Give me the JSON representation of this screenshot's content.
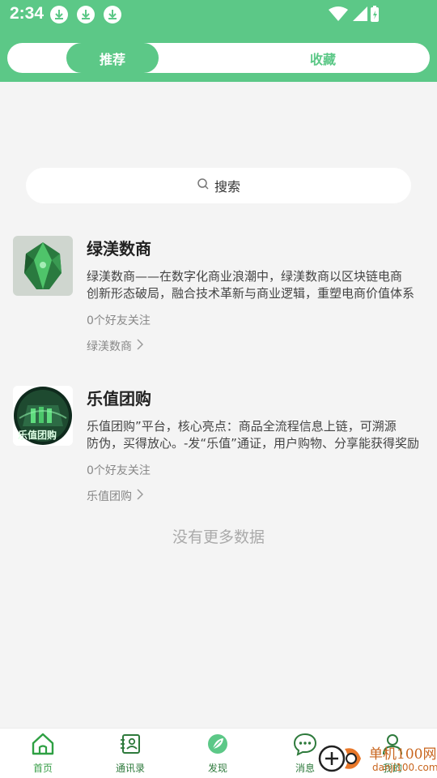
{
  "status_bar": {
    "time": "2:34"
  },
  "tabs": [
    {
      "label": "推荐",
      "active": true
    },
    {
      "label": "收藏",
      "active": false
    }
  ],
  "search": {
    "label": "搜索"
  },
  "items": [
    {
      "title": "绿渼数商",
      "desc_line1": "绿渼数商——在数字化商业浪潮中，绿渼数商以区块链电商",
      "desc_line2": "创新形态破局，融合技术革新与商业逻辑，重塑电商价值体系",
      "followers": "0个好友关注",
      "link": "绿渼数商"
    },
    {
      "title": "乐值团购",
      "desc_line1": "乐值团购”平台，核心亮点：商品全流程信息上链，可溯源",
      "desc_line2": "防伪，买得放心。-发“乐值”通证，用户购物、分享能获得奖励",
      "followers": "0个好友关注",
      "link": "乐值团购",
      "thumb_text": "乐值团购"
    }
  ],
  "no_more": "没有更多数据",
  "bottom_nav": [
    {
      "label": "首页",
      "icon": "home-icon"
    },
    {
      "label": "通讯录",
      "icon": "contacts-icon"
    },
    {
      "label": "发现",
      "icon": "discover-icon"
    },
    {
      "label": "消息",
      "icon": "message-icon"
    },
    {
      "label": "我的",
      "icon": "profile-icon"
    }
  ],
  "watermark": {
    "text": "单机100网",
    "sub": "danji100.com"
  },
  "colors": {
    "brand": "#5cc887",
    "nav_label": "#3a9f4a"
  }
}
